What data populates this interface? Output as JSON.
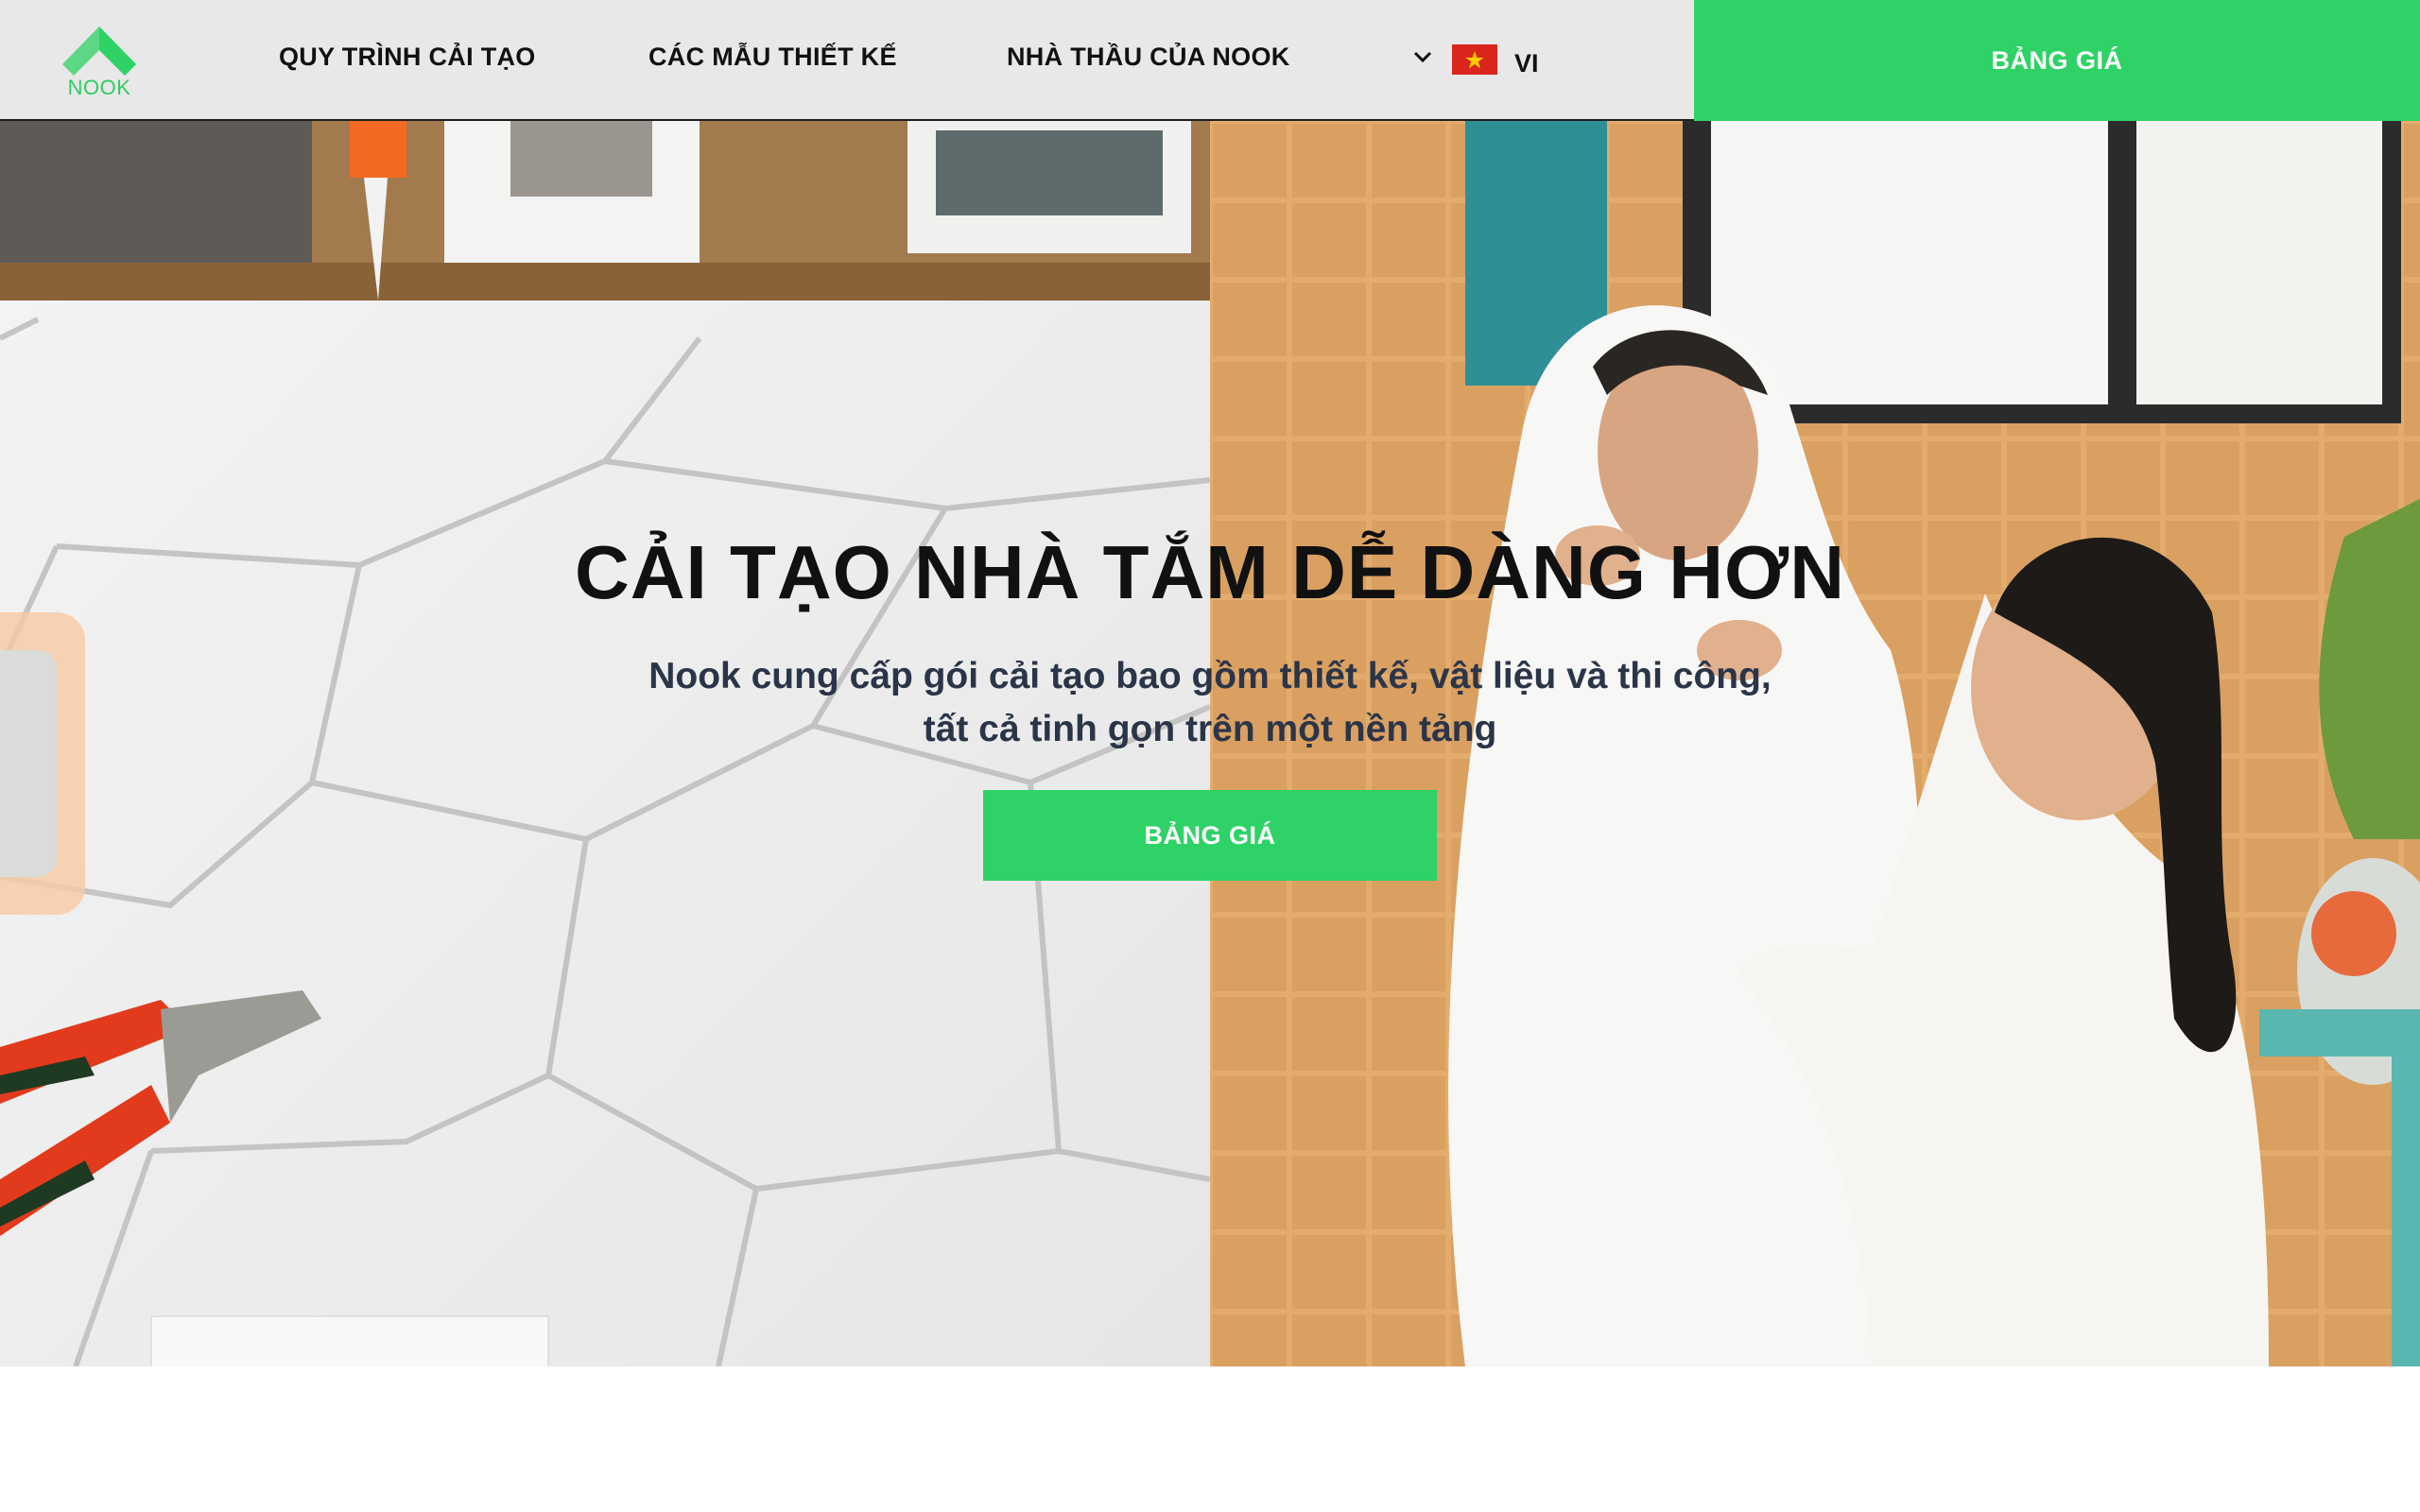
{
  "brand": {
    "name": "NOOK",
    "color": "#2ed266"
  },
  "nav": {
    "items": [
      {
        "label": "QUY TRÌNH CẢI TẠO"
      },
      {
        "label": "CÁC MẪU THIẾT KẾ"
      },
      {
        "label": "NHÀ THẦU CỦA NOOK"
      }
    ],
    "language": {
      "code": "VI",
      "flag_icon": "vietnam-flag-icon",
      "dropdown_icon": "chevron-down-icon"
    },
    "cta_label": "BẢNG GIÁ"
  },
  "hero": {
    "title": "CẢI TẠO NHÀ TẮM DỄ DÀNG HƠN",
    "subtitle": "Nook cung cấp gói cải tạo bao gồm thiết kế, vật liệu và thi công, tất cả tinh gọn trên một nền tảng",
    "cta_label": "BẢNG GIÁ"
  },
  "colors": {
    "accent": "#2ed266",
    "header_bg": "#e8e8e8",
    "title": "#111111",
    "subtitle": "#2b3548"
  }
}
